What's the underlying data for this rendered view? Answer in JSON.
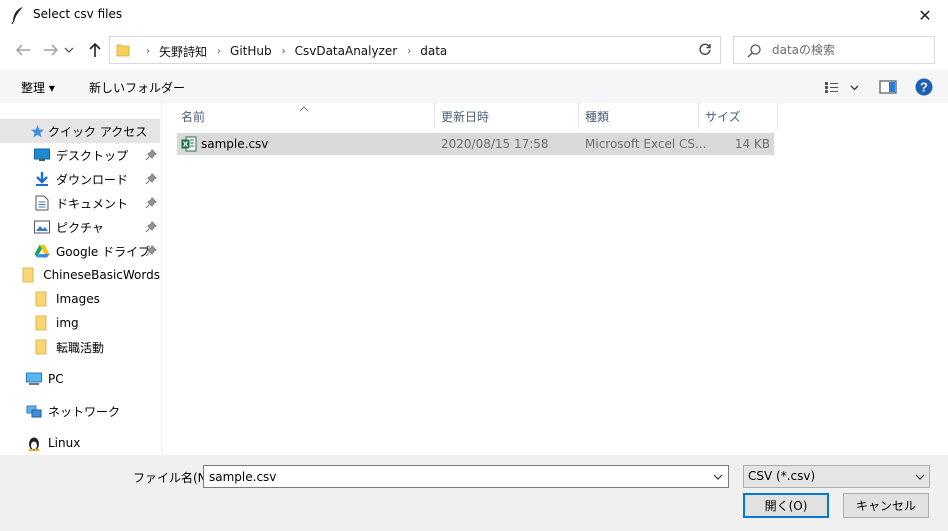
{
  "window": {
    "title": "Select csv files",
    "close_glyph": "✕"
  },
  "nav": {
    "back_icon": "arrow-left-icon",
    "forward_icon": "arrow-right-icon",
    "recent_icon": "chevron-down-icon",
    "up_icon": "arrow-up-icon",
    "breadcrumbs": [
      "矢野詩知",
      "GitHub",
      "CsvDataAnalyzer",
      "data"
    ],
    "separator": "›",
    "search_placeholder": "dataの検索"
  },
  "toolbar": {
    "organize_label": "整理 ▾",
    "new_folder_label": "新しいフォルダー"
  },
  "sidebar": {
    "quick_access": "クイック アクセス",
    "items": [
      {
        "label": "デスクトップ",
        "icon": "desktop-icon",
        "pinned": true
      },
      {
        "label": "ダウンロード",
        "icon": "download-icon",
        "pinned": true
      },
      {
        "label": "ドキュメント",
        "icon": "document-icon",
        "pinned": true
      },
      {
        "label": "ピクチャ",
        "icon": "picture-icon",
        "pinned": true
      },
      {
        "label": "Google ドライブ",
        "icon": "google-drive-icon",
        "pinned": true
      },
      {
        "label": "ChineseBasicWords",
        "icon": "folder-icon",
        "pinned": false
      },
      {
        "label": "Images",
        "icon": "folder-icon",
        "pinned": false
      },
      {
        "label": "img",
        "icon": "folder-icon",
        "pinned": false
      },
      {
        "label": "転職活動",
        "icon": "folder-icon",
        "pinned": false
      }
    ],
    "pc": "PC",
    "network": "ネットワーク",
    "linux": "Linux"
  },
  "filelist": {
    "columns": [
      "名前",
      "更新日時",
      "種類",
      "サイズ"
    ],
    "rows": [
      {
        "name": "sample.csv",
        "modified": "2020/08/15 17:58",
        "type": "Microsoft Excel CS...",
        "size": "14 KB"
      }
    ]
  },
  "footer": {
    "filename_label": "ファイル名(N):",
    "filename_value": "sample.csv",
    "filetype_value": "CSV (*.csv)",
    "open_label": "開く(O)",
    "cancel_label": "キャンセル"
  },
  "colors": {
    "accent": "#0078d7",
    "folder": "#f4cf5a",
    "excel": "#1d7044",
    "selection": "#d9d9d9",
    "header_text": "#4c607a"
  }
}
